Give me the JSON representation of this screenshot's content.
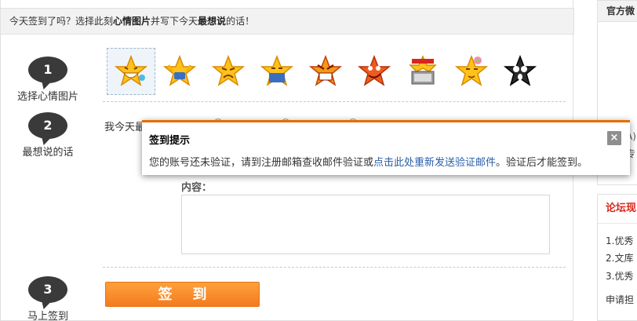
{
  "header": {
    "prefix": "今天签到了吗？选择此刻",
    "bold1": "心情图片",
    "middle": "并写下今天",
    "bold2": "最想说",
    "suffix": "的话！"
  },
  "steps": [
    {
      "number": "1",
      "label": "选择心情图片"
    },
    {
      "number": "2",
      "label": "最想说的话"
    },
    {
      "number": "3",
      "label": "马上签到"
    }
  ],
  "faces": [
    {
      "name": "happy-face-icon",
      "selected": true
    },
    {
      "name": "excited-face-icon",
      "selected": false
    },
    {
      "name": "annoyed-face-icon",
      "selected": false
    },
    {
      "name": "bored-face-icon",
      "selected": false
    },
    {
      "name": "angry-face-icon",
      "selected": false
    },
    {
      "name": "wink-face-icon",
      "selected": false
    },
    {
      "name": "computer-face-icon",
      "selected": false
    },
    {
      "name": "flower-face-icon",
      "selected": false
    },
    {
      "name": "scared-face-icon",
      "selected": false
    }
  ],
  "mood": {
    "label": "我今天最"
  },
  "content": {
    "label": "内容：",
    "value": ""
  },
  "sign_button": {
    "label": "签到"
  },
  "sidebar": {
    "box1_title": "官方微",
    "box1_line1": "A)",
    "box1_line2": "专",
    "box2_title": "论坛现",
    "items": [
      "1.优秀",
      "2.文库",
      "3.优秀"
    ],
    "footer": "申请担"
  },
  "modal": {
    "title": "签到提示",
    "text_before": "您的账号还未验证，请到注册邮箱查收邮件验证或",
    "link": "点击此处重新发送验证邮件",
    "text_after": "。验证后才能签到。",
    "close": "×"
  },
  "colors": {
    "accent": "#f37b1d",
    "modal_border": "#e36d00",
    "link": "#2a5fa8",
    "sidebar_title_red": "#d9251c"
  }
}
